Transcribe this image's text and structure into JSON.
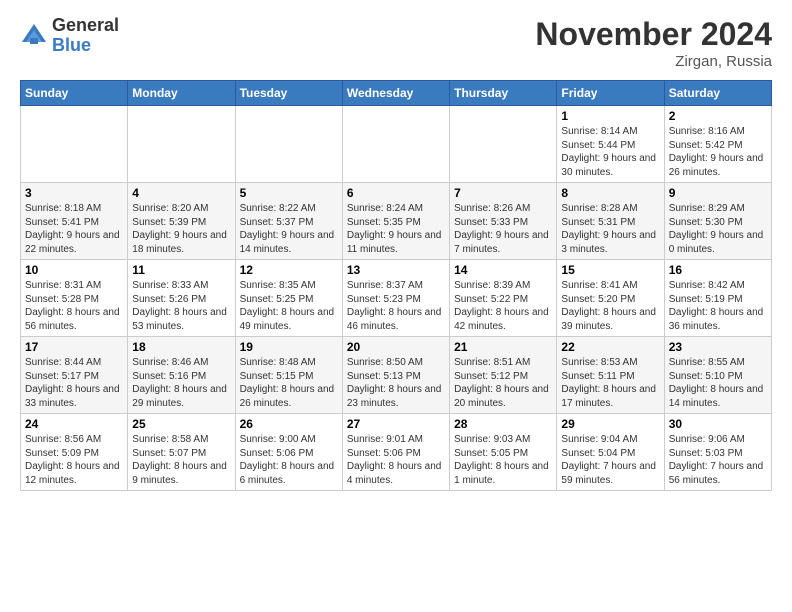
{
  "header": {
    "logo_general": "General",
    "logo_blue": "Blue",
    "month_title": "November 2024",
    "location": "Zirgan, Russia"
  },
  "weekdays": [
    "Sunday",
    "Monday",
    "Tuesday",
    "Wednesday",
    "Thursday",
    "Friday",
    "Saturday"
  ],
  "weeks": [
    [
      {
        "day": "",
        "info": ""
      },
      {
        "day": "",
        "info": ""
      },
      {
        "day": "",
        "info": ""
      },
      {
        "day": "",
        "info": ""
      },
      {
        "day": "",
        "info": ""
      },
      {
        "day": "1",
        "info": "Sunrise: 8:14 AM\nSunset: 5:44 PM\nDaylight: 9 hours and 30 minutes."
      },
      {
        "day": "2",
        "info": "Sunrise: 8:16 AM\nSunset: 5:42 PM\nDaylight: 9 hours and 26 minutes."
      }
    ],
    [
      {
        "day": "3",
        "info": "Sunrise: 8:18 AM\nSunset: 5:41 PM\nDaylight: 9 hours and 22 minutes."
      },
      {
        "day": "4",
        "info": "Sunrise: 8:20 AM\nSunset: 5:39 PM\nDaylight: 9 hours and 18 minutes."
      },
      {
        "day": "5",
        "info": "Sunrise: 8:22 AM\nSunset: 5:37 PM\nDaylight: 9 hours and 14 minutes."
      },
      {
        "day": "6",
        "info": "Sunrise: 8:24 AM\nSunset: 5:35 PM\nDaylight: 9 hours and 11 minutes."
      },
      {
        "day": "7",
        "info": "Sunrise: 8:26 AM\nSunset: 5:33 PM\nDaylight: 9 hours and 7 minutes."
      },
      {
        "day": "8",
        "info": "Sunrise: 8:28 AM\nSunset: 5:31 PM\nDaylight: 9 hours and 3 minutes."
      },
      {
        "day": "9",
        "info": "Sunrise: 8:29 AM\nSunset: 5:30 PM\nDaylight: 9 hours and 0 minutes."
      }
    ],
    [
      {
        "day": "10",
        "info": "Sunrise: 8:31 AM\nSunset: 5:28 PM\nDaylight: 8 hours and 56 minutes."
      },
      {
        "day": "11",
        "info": "Sunrise: 8:33 AM\nSunset: 5:26 PM\nDaylight: 8 hours and 53 minutes."
      },
      {
        "day": "12",
        "info": "Sunrise: 8:35 AM\nSunset: 5:25 PM\nDaylight: 8 hours and 49 minutes."
      },
      {
        "day": "13",
        "info": "Sunrise: 8:37 AM\nSunset: 5:23 PM\nDaylight: 8 hours and 46 minutes."
      },
      {
        "day": "14",
        "info": "Sunrise: 8:39 AM\nSunset: 5:22 PM\nDaylight: 8 hours and 42 minutes."
      },
      {
        "day": "15",
        "info": "Sunrise: 8:41 AM\nSunset: 5:20 PM\nDaylight: 8 hours and 39 minutes."
      },
      {
        "day": "16",
        "info": "Sunrise: 8:42 AM\nSunset: 5:19 PM\nDaylight: 8 hours and 36 minutes."
      }
    ],
    [
      {
        "day": "17",
        "info": "Sunrise: 8:44 AM\nSunset: 5:17 PM\nDaylight: 8 hours and 33 minutes."
      },
      {
        "day": "18",
        "info": "Sunrise: 8:46 AM\nSunset: 5:16 PM\nDaylight: 8 hours and 29 minutes."
      },
      {
        "day": "19",
        "info": "Sunrise: 8:48 AM\nSunset: 5:15 PM\nDaylight: 8 hours and 26 minutes."
      },
      {
        "day": "20",
        "info": "Sunrise: 8:50 AM\nSunset: 5:13 PM\nDaylight: 8 hours and 23 minutes."
      },
      {
        "day": "21",
        "info": "Sunrise: 8:51 AM\nSunset: 5:12 PM\nDaylight: 8 hours and 20 minutes."
      },
      {
        "day": "22",
        "info": "Sunrise: 8:53 AM\nSunset: 5:11 PM\nDaylight: 8 hours and 17 minutes."
      },
      {
        "day": "23",
        "info": "Sunrise: 8:55 AM\nSunset: 5:10 PM\nDaylight: 8 hours and 14 minutes."
      }
    ],
    [
      {
        "day": "24",
        "info": "Sunrise: 8:56 AM\nSunset: 5:09 PM\nDaylight: 8 hours and 12 minutes."
      },
      {
        "day": "25",
        "info": "Sunrise: 8:58 AM\nSunset: 5:07 PM\nDaylight: 8 hours and 9 minutes."
      },
      {
        "day": "26",
        "info": "Sunrise: 9:00 AM\nSunset: 5:06 PM\nDaylight: 8 hours and 6 minutes."
      },
      {
        "day": "27",
        "info": "Sunrise: 9:01 AM\nSunset: 5:06 PM\nDaylight: 8 hours and 4 minutes."
      },
      {
        "day": "28",
        "info": "Sunrise: 9:03 AM\nSunset: 5:05 PM\nDaylight: 8 hours and 1 minute."
      },
      {
        "day": "29",
        "info": "Sunrise: 9:04 AM\nSunset: 5:04 PM\nDaylight: 7 hours and 59 minutes."
      },
      {
        "day": "30",
        "info": "Sunrise: 9:06 AM\nSunset: 5:03 PM\nDaylight: 7 hours and 56 minutes."
      }
    ]
  ]
}
